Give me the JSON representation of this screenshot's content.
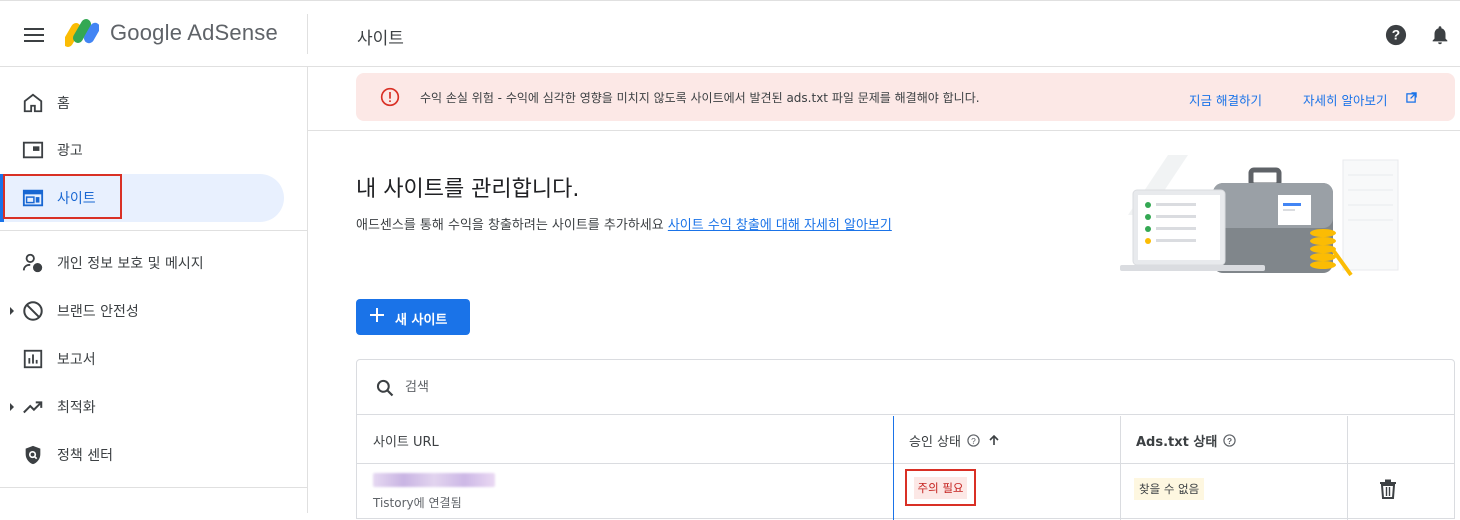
{
  "header": {
    "product_name": "Google AdSense",
    "page_title": "사이트"
  },
  "sidebar": {
    "items": [
      {
        "label": "홈",
        "icon": "home-icon"
      },
      {
        "label": "광고",
        "icon": "ads-icon"
      },
      {
        "label": "사이트",
        "icon": "sites-icon",
        "active": true
      },
      {
        "label": "개인 정보 보호 및 메시지",
        "icon": "privacy-icon"
      },
      {
        "label": "브랜드 안전성",
        "icon": "block-icon",
        "expandable": true
      },
      {
        "label": "보고서",
        "icon": "reports-icon"
      },
      {
        "label": "최적화",
        "icon": "trending-icon",
        "expandable": true
      },
      {
        "label": "정책 센터",
        "icon": "policy-shield-icon"
      }
    ]
  },
  "alert": {
    "message": "수익 손실 위험 - 수익에 심각한 영향을 미치지 않도록 사이트에서 발견된 ads.txt 파일 문제를 해결해야 합니다.",
    "fix_link": "지금 해결하기",
    "learn_link": "자세히 알아보기"
  },
  "intro": {
    "heading": "내 사이트를 관리합니다.",
    "subtext": "애드센스를 통해 수익을 창출하려는 사이트를 추가하세요",
    "link": "사이트 수익 창출에 대해 자세히 알아보기"
  },
  "toolbar": {
    "new_site_label": "새 사이트"
  },
  "table": {
    "search_placeholder": "검색",
    "columns": [
      "사이트 URL",
      "승인 상태",
      "Ads.txt 상태"
    ],
    "rows": [
      {
        "sub": "Tistory에 연결됨",
        "status": "주의 필요",
        "ads_txt": "찾을 수 없음"
      }
    ]
  },
  "colors": {
    "accent": "#1a73e8",
    "alert_bg": "#fce8e6",
    "error": "#d93025",
    "active_nav_bg": "#e8f0fe"
  }
}
